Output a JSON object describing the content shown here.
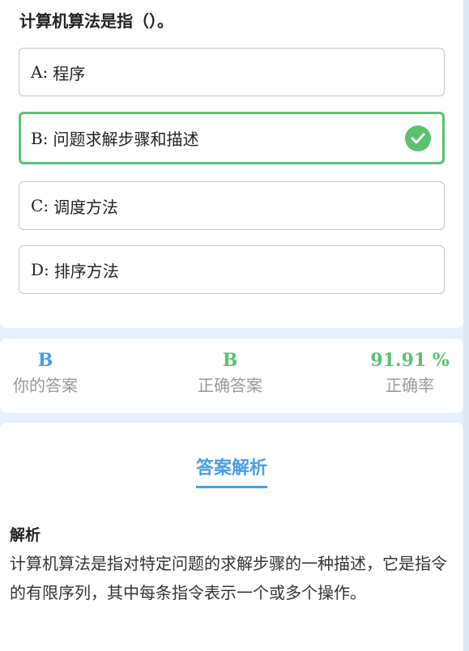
{
  "question": {
    "title": "计算机算法是指（）。",
    "options": [
      {
        "letter": "A",
        "text": "程序",
        "correct": false
      },
      {
        "letter": "B",
        "text": "问题求解步骤和描述",
        "correct": true
      },
      {
        "letter": "C",
        "text": "调度方法",
        "correct": false
      },
      {
        "letter": "D",
        "text": "排序方法",
        "correct": false
      }
    ],
    "correct_icon": "check-circle-icon"
  },
  "stats": {
    "your_answer": {
      "value": "B",
      "label": "你的答案",
      "color": "#4a9ee8"
    },
    "correct_answer": {
      "value": "B",
      "label": "正确答案",
      "color": "#5cc16f"
    },
    "accuracy": {
      "value": "91.91 %",
      "label": "正确率",
      "color": "#5cc16f"
    }
  },
  "analysis": {
    "heading": "答案解析",
    "subtitle": "解析",
    "body": "计算机算法是指对特定问题的求解步骤的一种描述，它是指令的有限序列，其中每条指令表示一个或多个操作。"
  },
  "colors": {
    "accent": "#4a9ee8",
    "correct": "#5cc16f",
    "background": "#e6f0fa"
  }
}
